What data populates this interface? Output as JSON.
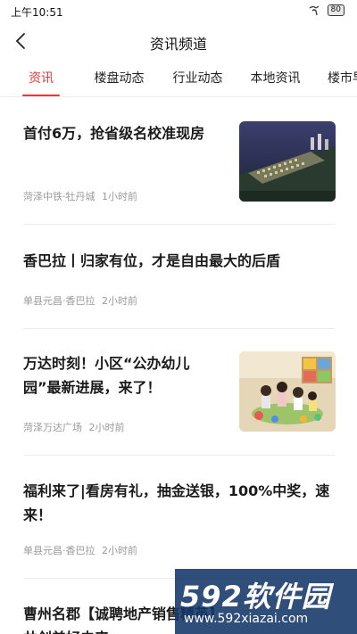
{
  "status_bar": {
    "time": "上午10:51",
    "battery": "80"
  },
  "header": {
    "title": "资讯频道"
  },
  "tabs": [
    {
      "label": "资讯"
    },
    {
      "label": "楼盘动态"
    },
    {
      "label": "行业动态"
    },
    {
      "label": "本地资讯"
    },
    {
      "label": "楼市早"
    }
  ],
  "articles": [
    {
      "title": "首付6万，抢省级名校准现房",
      "source": "菏泽中铁·牡丹城",
      "time": "1小时前",
      "thumbnail": "aerial-night-city-photo"
    },
    {
      "title": "香巴拉丨归家有位，才是自由最大的后盾",
      "source": "单县元昌·香巴拉",
      "time": "2小时前"
    },
    {
      "title_line1": "万达时刻！小区“公办幼儿",
      "title_line2": "园”最新进展，来了！",
      "source": "菏泽万达广场",
      "time": "2小时前",
      "thumbnail": "kindergarten-classroom-photo"
    },
    {
      "title_line1": "福利来了|看房有礼，抽金送银，100%中奖，速",
      "title_line2": "来！",
      "source": "单县元昌·香巴拉",
      "time": "2小时前"
    },
    {
      "title_line1": "曹州名郡【诚聘地产销售精英】",
      "title_line2": "共创美好未来"
    }
  ],
  "watermark": {
    "brand": "592软件园",
    "url": "www.592xiazai.com"
  }
}
